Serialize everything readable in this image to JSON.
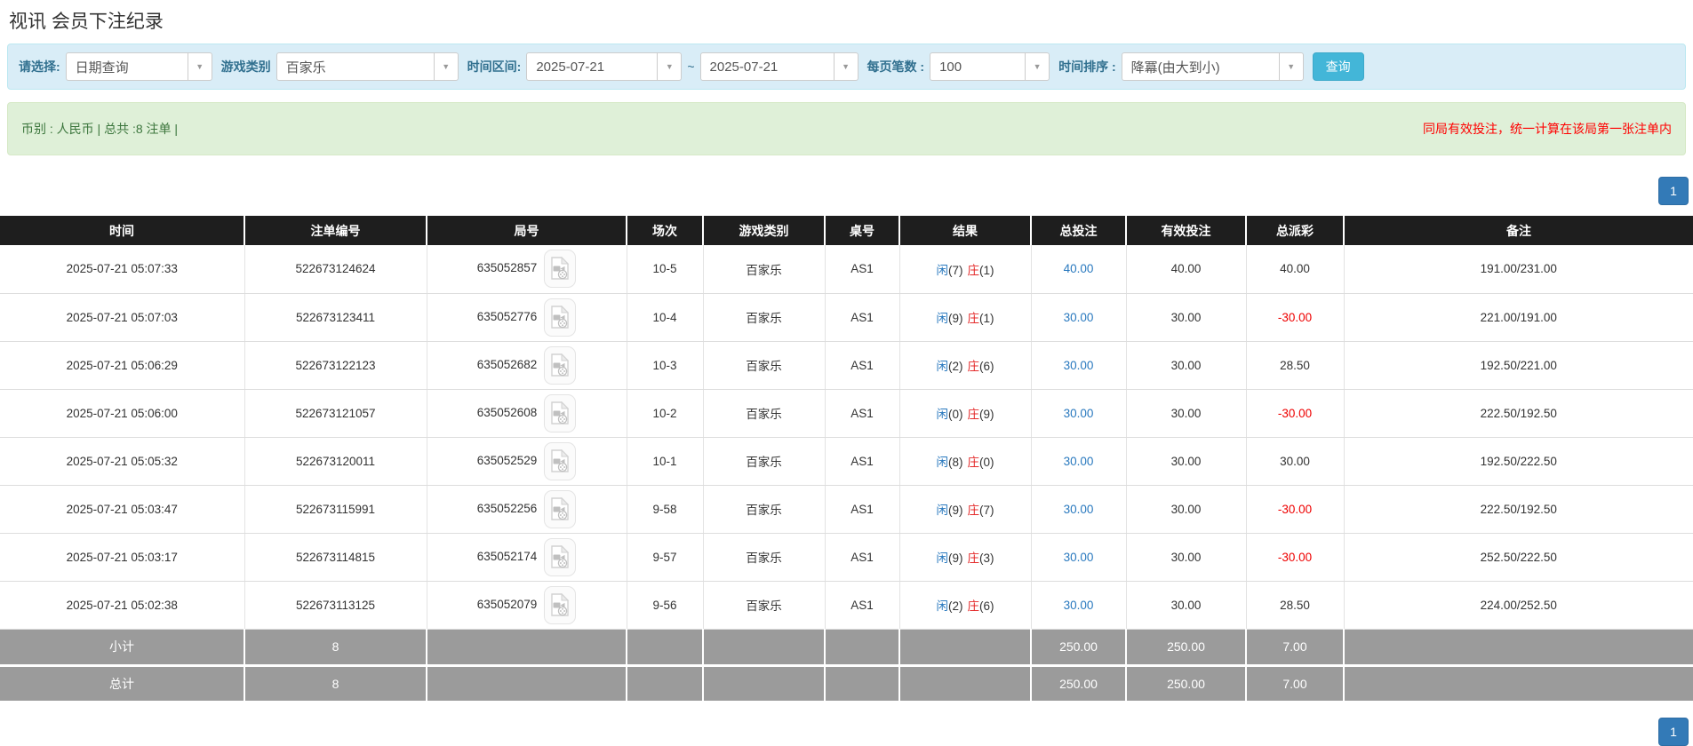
{
  "page": {
    "title": "视讯 会员下注纪录"
  },
  "filters": {
    "query_type": {
      "label": "请选择:",
      "value": "日期查询"
    },
    "game_type": {
      "label": "游戏类别",
      "value": "百家乐"
    },
    "date_range": {
      "label": "时间区间:",
      "from": "2025-07-21",
      "separator": "~",
      "to": "2025-07-21"
    },
    "page_size": {
      "label": "每页笔数 :",
      "value": "100"
    },
    "time_sort": {
      "label": "时间排序 :",
      "value": "降冪(由大到小)"
    },
    "search_button_label": "查询",
    "caret_glyph": "▼"
  },
  "summary": {
    "left": "币别 : 人民币 | 总共 :8 注单 |",
    "right_note": "同局有效投注，统一计算在该局第一张注单内"
  },
  "pagination": {
    "page": "1"
  },
  "table": {
    "headers": [
      "时间",
      "注单编号",
      "局号",
      "场次",
      "游戏类别",
      "桌号",
      "结果",
      "总投注",
      "有效投注",
      "总派彩",
      "备注"
    ],
    "rows": [
      {
        "time": "2025-07-21 05:07:33",
        "bet_id": "522673124624",
        "round_id": "635052857",
        "session": "10-5",
        "game": "百家乐",
        "table_no": "AS1",
        "r_player": "闲",
        "r_player_s": "(7)",
        "r_banker": "庄",
        "r_banker_s": "(1)",
        "total_bet": "40.00",
        "valid_bet": "40.00",
        "payout": "40.00",
        "payout_negative": false,
        "remark": "191.00/231.00"
      },
      {
        "time": "2025-07-21 05:07:03",
        "bet_id": "522673123411",
        "round_id": "635052776",
        "session": "10-4",
        "game": "百家乐",
        "table_no": "AS1",
        "r_player": "闲",
        "r_player_s": "(9)",
        "r_banker": "庄",
        "r_banker_s": "(1)",
        "total_bet": "30.00",
        "valid_bet": "30.00",
        "payout": "-30.00",
        "payout_negative": true,
        "remark": "221.00/191.00"
      },
      {
        "time": "2025-07-21 05:06:29",
        "bet_id": "522673122123",
        "round_id": "635052682",
        "session": "10-3",
        "game": "百家乐",
        "table_no": "AS1",
        "r_player": "闲",
        "r_player_s": "(2)",
        "r_banker": "庄",
        "r_banker_s": "(6)",
        "total_bet": "30.00",
        "valid_bet": "30.00",
        "payout": "28.50",
        "payout_negative": false,
        "remark": "192.50/221.00"
      },
      {
        "time": "2025-07-21 05:06:00",
        "bet_id": "522673121057",
        "round_id": "635052608",
        "session": "10-2",
        "game": "百家乐",
        "table_no": "AS1",
        "r_player": "闲",
        "r_player_s": "(0)",
        "r_banker": "庄",
        "r_banker_s": "(9)",
        "total_bet": "30.00",
        "valid_bet": "30.00",
        "payout": "-30.00",
        "payout_negative": true,
        "remark": "222.50/192.50"
      },
      {
        "time": "2025-07-21 05:05:32",
        "bet_id": "522673120011",
        "round_id": "635052529",
        "session": "10-1",
        "game": "百家乐",
        "table_no": "AS1",
        "r_player": "闲",
        "r_player_s": "(8)",
        "r_banker": "庄",
        "r_banker_s": "(0)",
        "total_bet": "30.00",
        "valid_bet": "30.00",
        "payout": "30.00",
        "payout_negative": false,
        "remark": "192.50/222.50"
      },
      {
        "time": "2025-07-21 05:03:47",
        "bet_id": "522673115991",
        "round_id": "635052256",
        "session": "9-58",
        "game": "百家乐",
        "table_no": "AS1",
        "r_player": "闲",
        "r_player_s": "(9)",
        "r_banker": "庄",
        "r_banker_s": "(7)",
        "total_bet": "30.00",
        "valid_bet": "30.00",
        "payout": "-30.00",
        "payout_negative": true,
        "remark": "222.50/192.50"
      },
      {
        "time": "2025-07-21 05:03:17",
        "bet_id": "522673114815",
        "round_id": "635052174",
        "session": "9-57",
        "game": "百家乐",
        "table_no": "AS1",
        "r_player": "闲",
        "r_player_s": "(9)",
        "r_banker": "庄",
        "r_banker_s": "(3)",
        "total_bet": "30.00",
        "valid_bet": "30.00",
        "payout": "-30.00",
        "payout_negative": true,
        "remark": "252.50/222.50"
      },
      {
        "time": "2025-07-21 05:02:38",
        "bet_id": "522673113125",
        "round_id": "635052079",
        "session": "9-56",
        "game": "百家乐",
        "table_no": "AS1",
        "r_player": "闲",
        "r_player_s": "(2)",
        "r_banker": "庄",
        "r_banker_s": "(6)",
        "total_bet": "30.00",
        "valid_bet": "30.00",
        "payout": "28.50",
        "payout_negative": false,
        "remark": "224.00/252.50"
      }
    ],
    "subtotal": {
      "label": "小计",
      "count": "8",
      "total_bet": "250.00",
      "valid_bet": "250.00",
      "payout": "7.00"
    },
    "total": {
      "label": "总计",
      "count": "8",
      "total_bet": "250.00",
      "valid_bet": "250.00",
      "payout": "7.00"
    }
  },
  "colors": {
    "filter_bg": "#d9edf7",
    "filter_label": "#31708f",
    "query_button": "#43b6d8",
    "summary_bg": "#dff0d8",
    "summary_text": "#3c763d",
    "summary_note": "#ff0000",
    "header_bg": "#1e1e1e",
    "footer_bg": "#9b9b9b",
    "pager_bg": "#337ab7",
    "link_blue": "#2878be",
    "banker_red": "#e42b2b",
    "negative_red": "#ee0000"
  }
}
